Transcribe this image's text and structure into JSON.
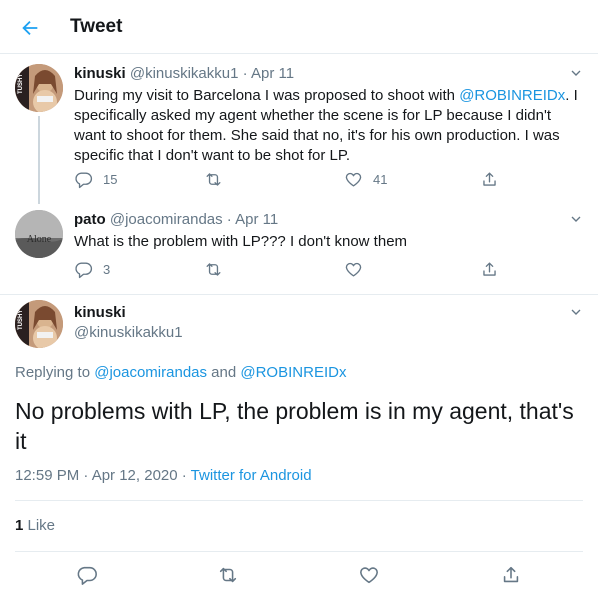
{
  "header": {
    "title": "Tweet"
  },
  "tweets": [
    {
      "name": "kinuski",
      "handle": "@kinuskikakku1",
      "date": "· Apr 11",
      "text_parts": [
        "During my visit to Barcelona I was proposed to shoot with ",
        "@ROBINREIDx",
        ". I specifically asked my agent whether the scene is for LP because I didn't want to shoot for them. She said that no, it's for his own production. I was specific that I don't want to be shot for LP."
      ],
      "replies": "15",
      "retweets": "",
      "likes": "41",
      "avatar_text": "TUSHY"
    },
    {
      "name": "pato",
      "handle": "@joacomirandas",
      "date": "· Apr 11",
      "text": "What is the problem with LP??? I don't know them",
      "replies": "3",
      "retweets": "",
      "likes": "",
      "avatar_text": "Alone"
    }
  ],
  "main_tweet": {
    "name": "kinuski",
    "handle": "@kinuskikakku1",
    "avatar_text": "TUSHY",
    "replying_prefix": "Replying to ",
    "replying_user1": "@joacomirandas",
    "replying_and": " and ",
    "replying_user2": "@ROBINREIDx",
    "text": "No problems with LP, the problem is in my agent, that's it",
    "time": "12:59 PM · Apr 12, 2020 · ",
    "source": "Twitter for Android",
    "like_count": "1",
    "like_label": " Like"
  }
}
